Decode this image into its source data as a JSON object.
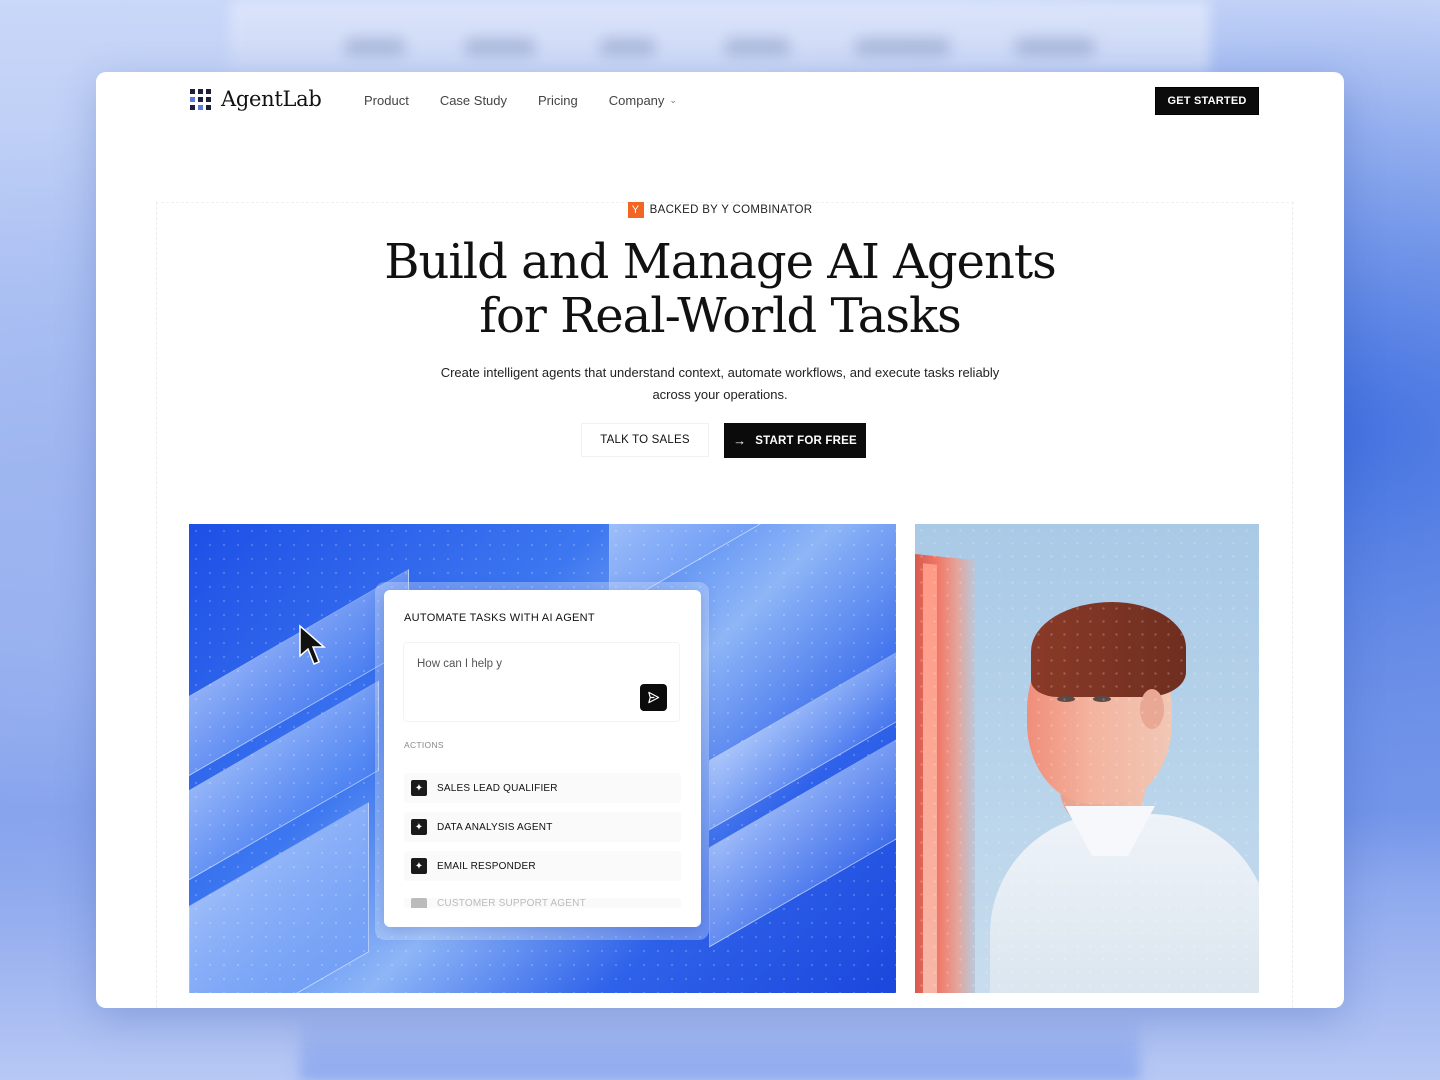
{
  "brand": {
    "name": "AgentLab"
  },
  "nav": {
    "links": [
      "Product",
      "Case Study",
      "Pricing",
      "Company"
    ],
    "cta": "GET STARTED"
  },
  "hero": {
    "badge_logo": "Y",
    "badge": "BACKED BY Y COMBINATOR",
    "title_line1": "Build and Manage AI Agents",
    "title_line2": "for Real-World Tasks",
    "subtitle_line1": "Create intelligent agents that understand context, automate workflows, and execute tasks reliably",
    "subtitle_line2": "across your operations.",
    "secondary_button": "TALK TO SALES",
    "primary_button": "START FOR FREE"
  },
  "agent_panel": {
    "title": "AUTOMATE TASKS WITH AI AGENT",
    "input_value": "How can I help y",
    "actions_label": "ACTIONS",
    "actions": [
      "SALES LEAD QUALIFIER",
      "DATA ANALYSIS AGENT",
      "EMAIL RESPONDER",
      "CUSTOMER SUPPORT AGENT"
    ]
  },
  "colors": {
    "accent": "#0b0b0b",
    "yc_orange": "#f26522",
    "hero_blue": "#2f62ea"
  },
  "icons": {
    "logo": "grid-dots-icon",
    "dropdown": "chevron-down-icon",
    "arrow": "arrow-right-icon",
    "send": "send-icon",
    "action": "sparkle-icon",
    "pointer": "cursor-icon"
  }
}
